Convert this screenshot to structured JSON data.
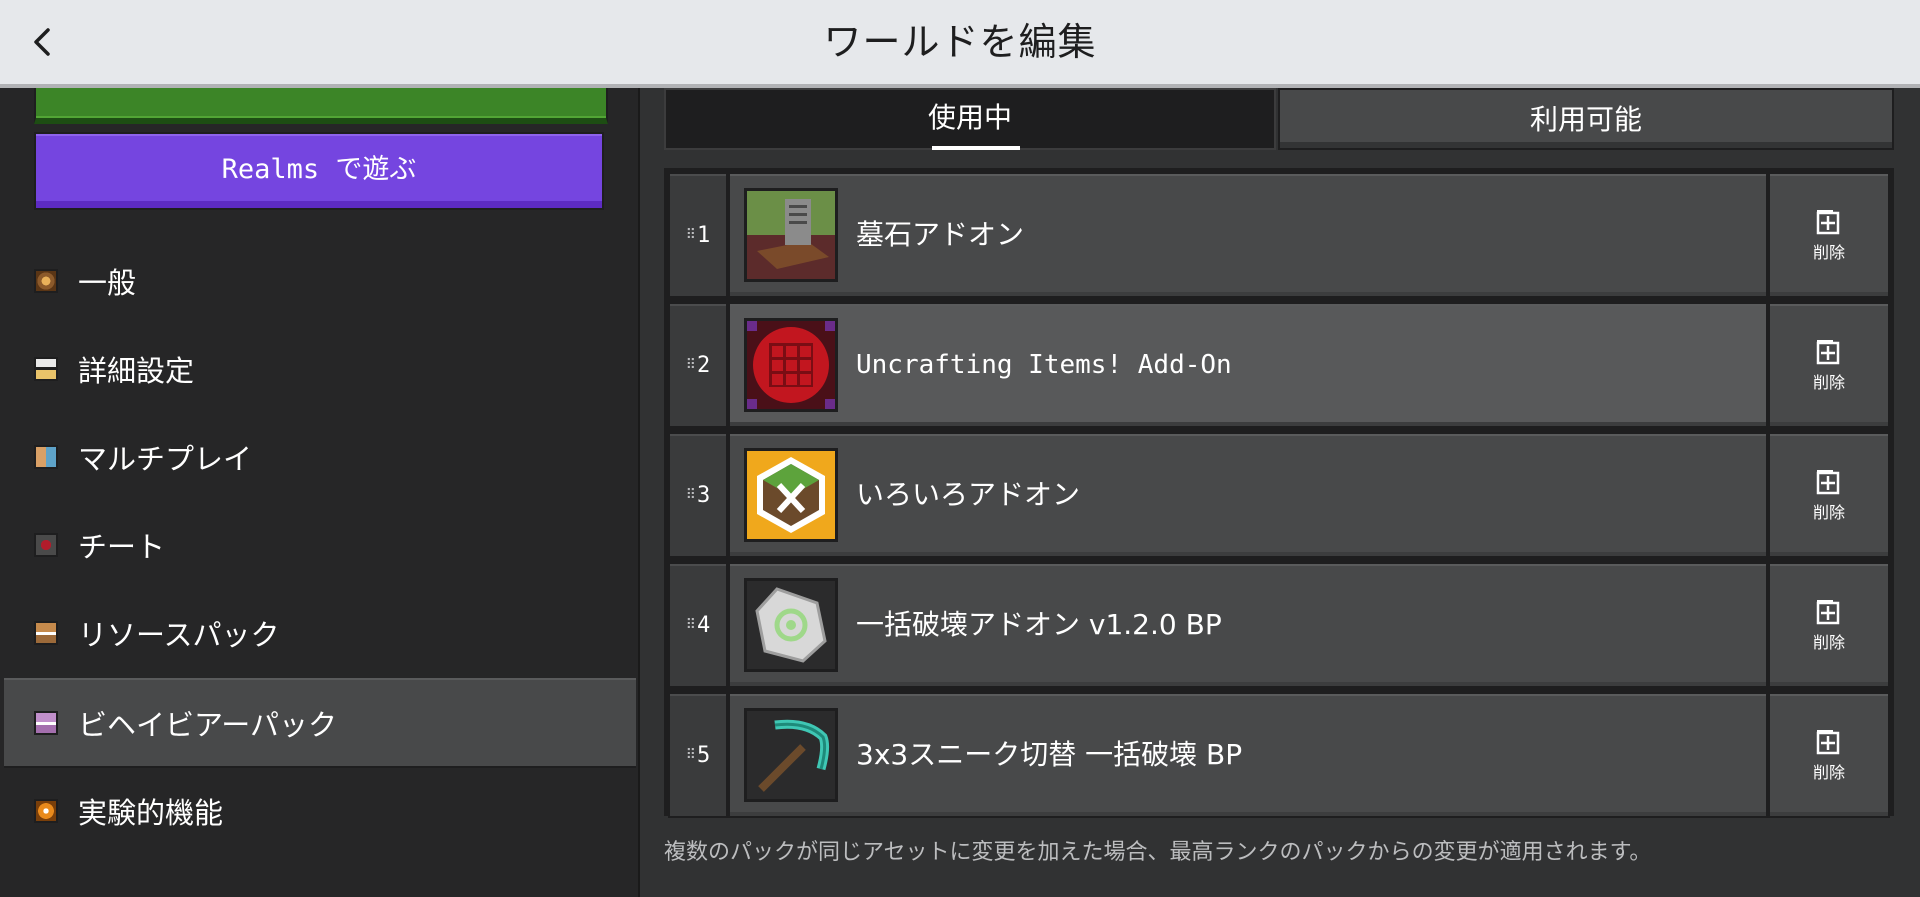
{
  "header": {
    "title": "ワールドを編集",
    "back_icon": "chevron-left-icon"
  },
  "sidebar": {
    "top_button_label": "",
    "realms_button_label": "Realms で遊ぶ",
    "items": [
      {
        "label": "一般",
        "icon": "general-icon",
        "color": "#8c5a2b",
        "selected": false
      },
      {
        "label": "詳細設定",
        "icon": "advanced-icon",
        "color": "#d8d8d8",
        "selected": false
      },
      {
        "label": "マルチプレイ",
        "icon": "multiplayer-icon",
        "color": "#5ea3c9",
        "selected": false
      },
      {
        "label": "チート",
        "icon": "cheats-icon",
        "color": "#b21c2b",
        "selected": false
      },
      {
        "label": "リソースパック",
        "icon": "resource-pack-icon",
        "color": "#9c6a3a",
        "selected": false
      },
      {
        "label": "ビヘイビアーパック",
        "icon": "behavior-pack-icon",
        "color": "#a46fae",
        "selected": true
      },
      {
        "label": "実験的機能",
        "icon": "experiments-icon",
        "color": "#e98a1c",
        "selected": false
      }
    ]
  },
  "tabs": {
    "active": "使用中",
    "available": "利用可能"
  },
  "packs": [
    {
      "rank": "1",
      "name": "墓石アドオン",
      "icon": "gravestone-pack-icon",
      "delete_label": "削除"
    },
    {
      "rank": "2",
      "name": "Uncrafting Items! Add-On",
      "icon": "uncrafting-pack-icon",
      "delete_label": "削除"
    },
    {
      "rank": "3",
      "name": "いろいろアドオン",
      "icon": "tools-pack-icon",
      "delete_label": "削除"
    },
    {
      "rank": "4",
      "name": "一括破壊アドオン v1.2.0 BP",
      "icon": "mass-break-pack-icon",
      "delete_label": "削除"
    },
    {
      "rank": "5",
      "name": "3x3スニーク切替 一括破壊 BP",
      "icon": "pickaxe-pack-icon",
      "delete_label": "削除"
    }
  ],
  "footer_note": "複数のパックが同じアセットに変更を加えた場合、最高ランクのパックからの変更が適用されます。",
  "colors": {
    "header_bg": "#e6e8eb",
    "realms_purple": "#7545e0",
    "green_button": "#3c8527",
    "panel_dark": "#1e1e1f",
    "row_bg": "#48494a"
  }
}
